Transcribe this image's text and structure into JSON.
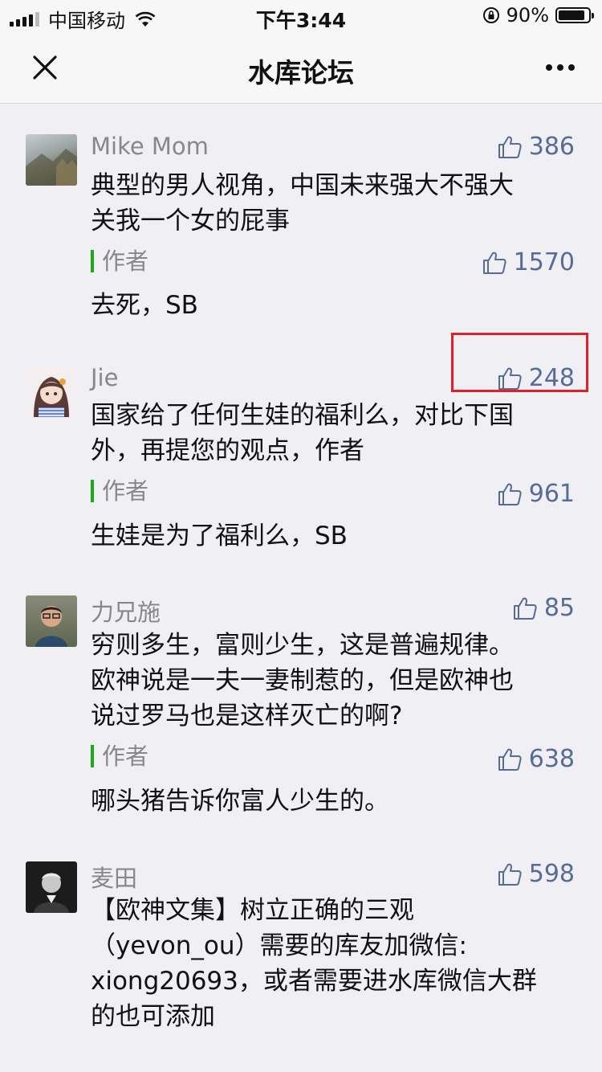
{
  "status_bar": {
    "carrier": "中国移动",
    "time": "下午3:44",
    "battery_pct": "90%",
    "battery_level": 0.9
  },
  "nav": {
    "title": "水库论坛",
    "close_icon": "close-icon",
    "more_icon": "more-icon"
  },
  "comments": [
    {
      "user": "Mike Mom",
      "likes": "386",
      "text_lines": [
        "典型的男人视角，中国未来强大不强大",
        "关我一个女的屁事"
      ],
      "author_label": "作者",
      "reply_likes": "1570",
      "reply": "去死，SB"
    },
    {
      "user": "Jie",
      "likes": "248",
      "text_lines": [
        "国家给了任何生娃的福利么，对比下国",
        "外，再提您的观点，作者"
      ],
      "author_label": "作者",
      "reply_likes": "961",
      "reply": "生娃是为了福利么，SB"
    },
    {
      "user": "力兄施",
      "likes": "85",
      "text_lines": [
        "穷则多生，富则少生，这是普遍规律。",
        "欧神说是一夫一妻制惹的，但是欧神也",
        "说过罗马也是这样灭亡的啊?"
      ],
      "author_label": "作者",
      "reply_likes": "638",
      "reply": "哪头猪告诉你富人少生的。"
    },
    {
      "user": "麦田",
      "likes": "598",
      "text_lines": [
        "【欧神文集】树立正确的三观",
        "（yevon_ou）需要的库友加微信:",
        "xiong20693，或者需要进水库微信大群",
        "的也可添加"
      ]
    }
  ],
  "colors": {
    "accent_link": "#576b95",
    "author_bar": "#1aad19",
    "highlight": "#e0202a"
  },
  "icons": {
    "like": "thumbs-up-icon"
  }
}
